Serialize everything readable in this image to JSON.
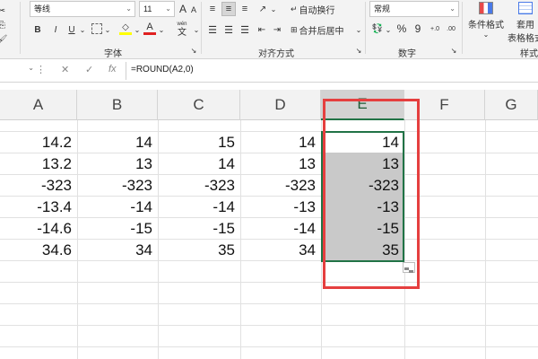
{
  "ribbon": {
    "font_name": "等线",
    "font_size": "11",
    "font_size_up": "A",
    "font_size_down": "A",
    "bold": "B",
    "italic": "I",
    "underline": "U",
    "font_color_glyph": "A",
    "wen_label": "wén",
    "wen_char": "文",
    "wrap_text": "自动换行",
    "merge_center": "合并后居中",
    "number_format": "常规",
    "percent": "%",
    "comma": "9",
    "cond_format": "条件格式",
    "table_format_1": "套用",
    "table_format_2": "表格格式",
    "groups": {
      "font": "字体",
      "alignment": "对齐方式",
      "number": "数字",
      "styles": "样式"
    }
  },
  "formula_bar": {
    "fx": "fx",
    "formula": "=ROUND(A2,0)"
  },
  "columns": [
    "A",
    "B",
    "C",
    "D",
    "E",
    "F",
    "G"
  ],
  "rows": [
    [
      "14.2",
      "14",
      "15",
      "14",
      "14"
    ],
    [
      "13.2",
      "13",
      "14",
      "13",
      "13"
    ],
    [
      "-323",
      "-323",
      "-323",
      "-323",
      "-323"
    ],
    [
      "-13.4",
      "-14",
      "-14",
      "-13",
      "-13"
    ],
    [
      "-14.6",
      "-15",
      "-15",
      "-14",
      "-15"
    ],
    [
      "34.6",
      "34",
      "35",
      "34",
      "35"
    ]
  ],
  "colors": {
    "accent": "#217346",
    "highlight_box": "#e53f3f",
    "selection_fill": "#c9c9c9"
  }
}
